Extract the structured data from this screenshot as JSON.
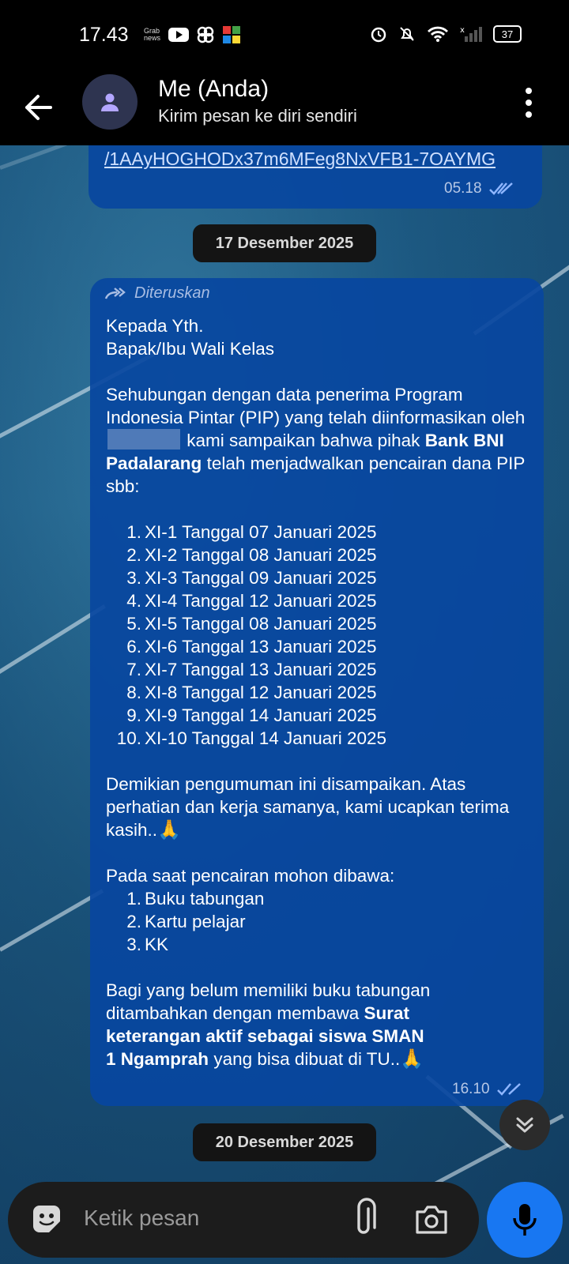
{
  "status_bar": {
    "time": "17.43",
    "battery": "37",
    "notif_small_text": "Grab\nnewsflash"
  },
  "header": {
    "title": "Me (Anda)",
    "subtitle": "Kirim pesan ke diri sendiri"
  },
  "messages": [
    {
      "type": "link",
      "text": "/1AAyHOGHODx37m6MFeg8NxVFB1-7OAYMG",
      "time": "05.18"
    },
    {
      "type": "date",
      "text": "17 Desember 2025"
    },
    {
      "type": "forwarded",
      "forwarded_label": "Diteruskan",
      "greeting1": "Kepada Yth.",
      "greeting2": "Bapak/Ibu Wali Kelas",
      "para1_a": "Sehubungan dengan data penerima Program Indonesia Pintar (PIP) yang telah diinformasikan oleh",
      "para1_b": "kami sampaikan bahwa pihak",
      "para1_bold": "Bank BNI Padalarang",
      "para1_c": "telah menjadwalkan pencairan dana PIP sbb:",
      "schedule": [
        "XI-1 Tanggal 07 Januari 2025",
        "XI-2 Tanggal 08 Januari 2025",
        "XI-3 Tanggal 09 Januari 2025",
        "XI-4 Tanggal 12 Januari 2025",
        "XI-5 Tanggal 08 Januari 2025",
        "XI-6 Tanggal 13 Januari 2025",
        "XI-7 Tanggal 13 Januari 2025",
        "XI-8 Tanggal 12 Januari 2025",
        "XI-9 Tanggal 14 Januari 2025",
        "XI-10 Tanggal 14 Januari 2025"
      ],
      "para2": "Demikian pengumuman ini disampaikan. Atas perhatian dan kerja samanya, kami ucapkan terima kasih..",
      "para3": "Pada saat pencairan mohon dibawa:",
      "bring": [
        "Buku tabungan",
        "Kartu pelajar",
        "KK"
      ],
      "para4_a": "Bagi yang belum memiliki buku tabungan ditambahkan dengan membawa",
      "para4_bold": "Surat keterangan aktif sebagai siswa SMAN 1 Ngamprah",
      "para4_c": "yang bisa dibuat di TU..",
      "emoji": "🙏",
      "time": "16.10"
    },
    {
      "type": "date",
      "text": "20 Desember 2025"
    }
  ],
  "composer": {
    "placeholder": "Ketik pesan"
  },
  "colors": {
    "bubble": "#0846a0",
    "accent": "#1877f2",
    "bar": "#000000"
  }
}
